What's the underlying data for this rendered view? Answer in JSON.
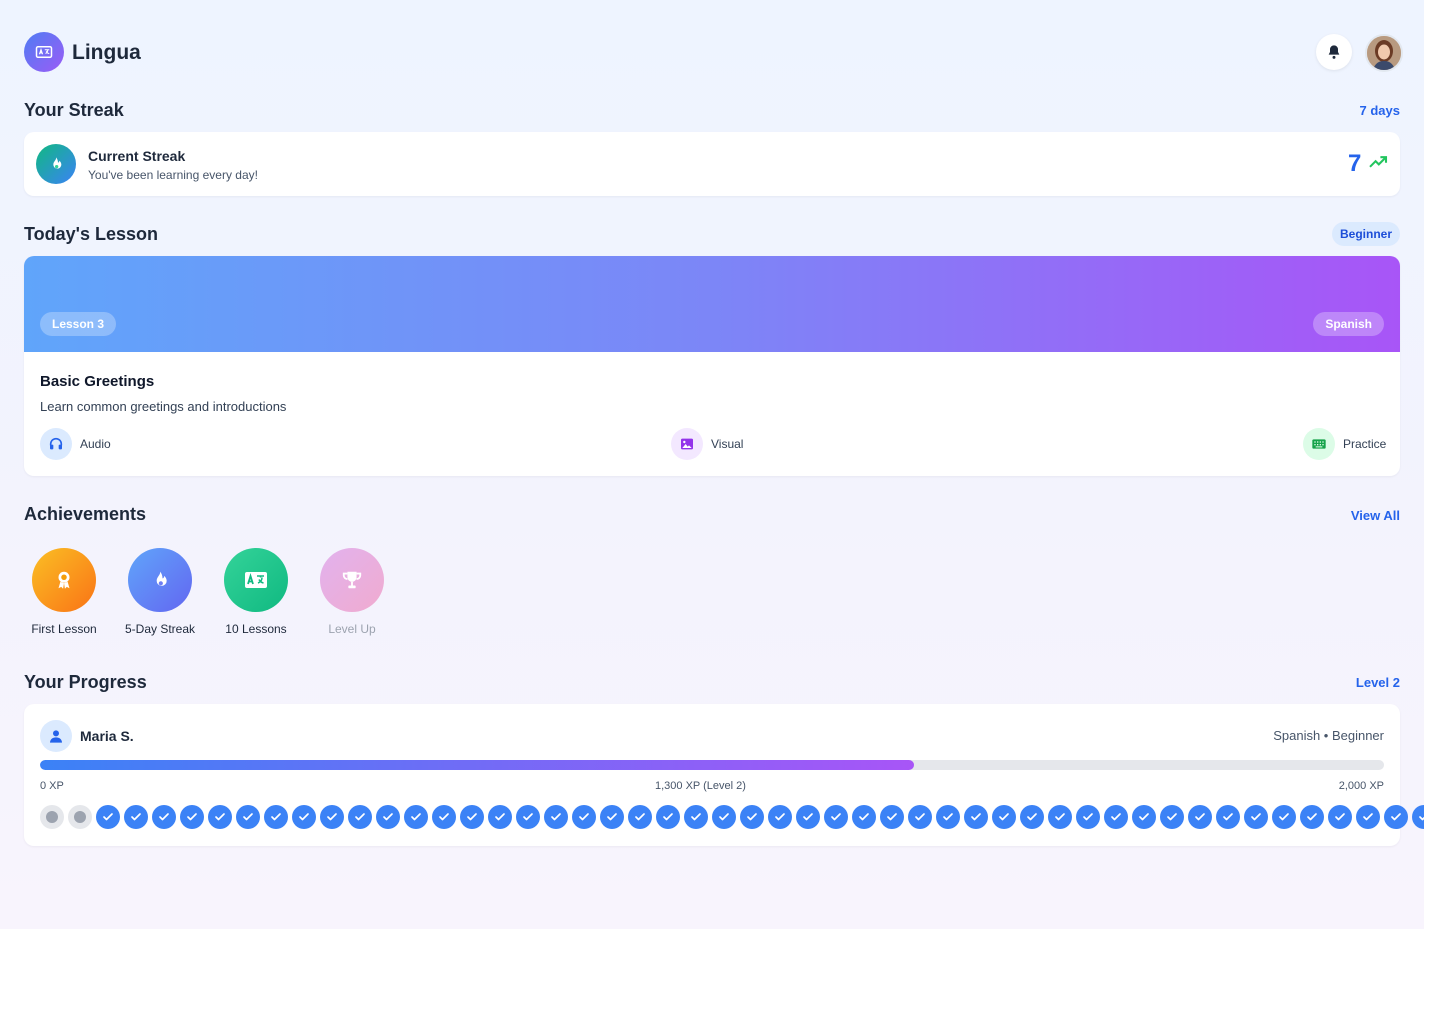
{
  "app": {
    "name": "Lingua",
    "icons": {
      "logo": "translate-icon",
      "notifications": "bell-icon"
    }
  },
  "streak": {
    "section_title": "Your Streak",
    "summary": "7 days",
    "label": "Current Streak",
    "subtitle": "You've been learning every day!",
    "count": "7",
    "trend_icon": "trending-up-icon"
  },
  "lesson": {
    "section_title": "Today's Lesson",
    "level_badge": "Beginner",
    "number_label": "Lesson 3",
    "language_label": "Spanish",
    "title": "Basic Greetings",
    "description": "Learn common greetings and introductions",
    "features": [
      {
        "label": "Audio",
        "icon": "headphones-icon"
      },
      {
        "label": "Visual",
        "icon": "image-icon"
      },
      {
        "label": "Practice",
        "icon": "keyboard-icon"
      }
    ]
  },
  "achievements": {
    "section_title": "Achievements",
    "view_all_label": "View All",
    "items": [
      {
        "label": "First Lesson",
        "icon": "medal-icon",
        "unlocked": true
      },
      {
        "label": "5-Day Streak",
        "icon": "flame-icon",
        "unlocked": true
      },
      {
        "label": "10 Lessons",
        "icon": "translate-icon",
        "unlocked": true
      },
      {
        "label": "Level Up",
        "icon": "trophy-icon",
        "unlocked": false
      }
    ]
  },
  "progress": {
    "section_title": "Your Progress",
    "level_label": "Level 2",
    "user_name": "Maria S.",
    "user_meta": "Spanish • Beginner",
    "xp_fraction": 0.65,
    "xp_start": "0 XP",
    "xp_current": "1,300 XP (Level 2)",
    "xp_max": "2,000 XP",
    "incomplete_count": 2,
    "complete_count": 48
  },
  "colors": {
    "accent": "#2563eb",
    "success": "#10b981",
    "purple": "#a855f7"
  }
}
